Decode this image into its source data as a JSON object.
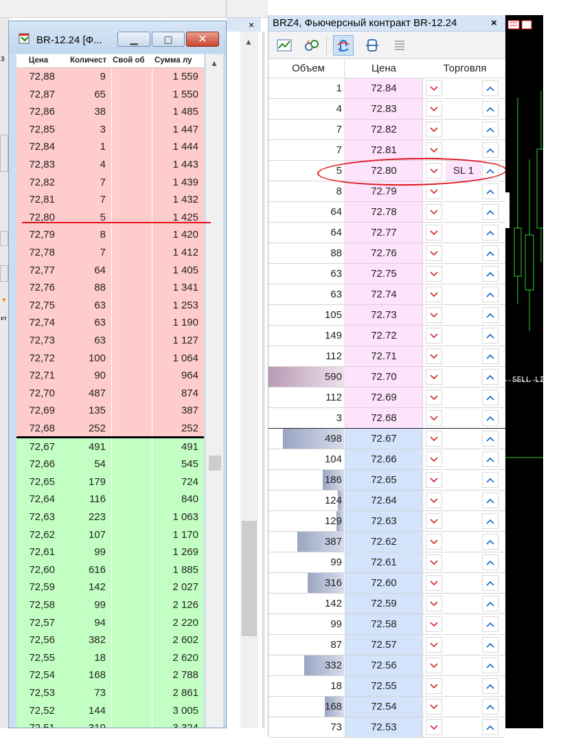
{
  "left_window": {
    "title": "BR-12.24 [Ф...",
    "columns": [
      "Цена",
      "Количест",
      "Свой об",
      "Сумма лу"
    ],
    "asks": [
      [
        "72,88",
        "9",
        "1 559"
      ],
      [
        "72,87",
        "65",
        "1 550"
      ],
      [
        "72,86",
        "38",
        "1 485"
      ],
      [
        "72,85",
        "3",
        "1 447"
      ],
      [
        "72,84",
        "1",
        "1 444"
      ],
      [
        "72,83",
        "4",
        "1 443"
      ],
      [
        "72,82",
        "7",
        "1 439"
      ],
      [
        "72,81",
        "7",
        "1 432"
      ],
      [
        "72,80",
        "5",
        "1 425"
      ],
      [
        "72,79",
        "8",
        "1 420"
      ],
      [
        "72,78",
        "7",
        "1 412"
      ],
      [
        "72,77",
        "64",
        "1 405"
      ],
      [
        "72,76",
        "88",
        "1 341"
      ],
      [
        "72,75",
        "63",
        "1 253"
      ],
      [
        "72,74",
        "63",
        "1 190"
      ],
      [
        "72,73",
        "63",
        "1 127"
      ],
      [
        "72,72",
        "100",
        "1 064"
      ],
      [
        "72,71",
        "90",
        "964"
      ],
      [
        "72,70",
        "487",
        "874"
      ],
      [
        "72,69",
        "135",
        "387"
      ],
      [
        "72,68",
        "252",
        "252"
      ]
    ],
    "bids": [
      [
        "72,67",
        "491",
        "491"
      ],
      [
        "72,66",
        "54",
        "545"
      ],
      [
        "72,65",
        "179",
        "724"
      ],
      [
        "72,64",
        "116",
        "840"
      ],
      [
        "72,63",
        "223",
        "1 063"
      ],
      [
        "72,62",
        "107",
        "1 170"
      ],
      [
        "72,61",
        "99",
        "1 269"
      ],
      [
        "72,60",
        "616",
        "1 885"
      ],
      [
        "72,59",
        "142",
        "2 027"
      ],
      [
        "72,58",
        "99",
        "2 126"
      ],
      [
        "72,57",
        "94",
        "2 220"
      ],
      [
        "72,56",
        "382",
        "2 602"
      ],
      [
        "72,55",
        "18",
        "2 620"
      ],
      [
        "72,54",
        "168",
        "2 788"
      ],
      [
        "72,53",
        "73",
        "2 861"
      ],
      [
        "72,52",
        "144",
        "3 005"
      ],
      [
        "72,51",
        "319",
        "3 324"
      ]
    ]
  },
  "left_edge_glyph": "3",
  "left_edge_text": "кт",
  "dom_window": {
    "title": "BRZ4, Фьючерсный контракт BR-12.24",
    "close_label": "×",
    "headers": {
      "volume": "Объем",
      "price": "Цена",
      "trade": "Торговля"
    },
    "asks": [
      {
        "vol": "1",
        "price": "72.84"
      },
      {
        "vol": "4",
        "price": "72.83"
      },
      {
        "vol": "7",
        "price": "72.82"
      },
      {
        "vol": "7",
        "price": "72.81"
      },
      {
        "vol": "5",
        "price": "72.80",
        "order": "SL 1"
      },
      {
        "vol": "8",
        "price": "72.79"
      },
      {
        "vol": "64",
        "price": "72.78"
      },
      {
        "vol": "64",
        "price": "72.77"
      },
      {
        "vol": "88",
        "price": "72.76"
      },
      {
        "vol": "63",
        "price": "72.75"
      },
      {
        "vol": "63",
        "price": "72.74"
      },
      {
        "vol": "105",
        "price": "72.73"
      },
      {
        "vol": "149",
        "price": "72.72"
      },
      {
        "vol": "112",
        "price": "72.71"
      },
      {
        "vol": "590",
        "price": "72.70",
        "depth": 1.0
      },
      {
        "vol": "112",
        "price": "72.69"
      },
      {
        "vol": "3",
        "price": "72.68"
      }
    ],
    "bids": [
      {
        "vol": "498",
        "price": "72.67",
        "depth": 0.81
      },
      {
        "vol": "104",
        "price": "72.66"
      },
      {
        "vol": "186",
        "price": "72.65",
        "depth": 0.28
      },
      {
        "vol": "124",
        "price": "72.64",
        "depth": 0.08
      },
      {
        "vol": "129",
        "price": "72.63",
        "depth": 0.1
      },
      {
        "vol": "387",
        "price": "72.62",
        "depth": 0.62
      },
      {
        "vol": "99",
        "price": "72.61"
      },
      {
        "vol": "316",
        "price": "72.60",
        "depth": 0.48
      },
      {
        "vol": "142",
        "price": "72.59"
      },
      {
        "vol": "99",
        "price": "72.58"
      },
      {
        "vol": "87",
        "price": "72.57"
      },
      {
        "vol": "332",
        "price": "72.56",
        "depth": 0.53
      },
      {
        "vol": "18",
        "price": "72.55"
      },
      {
        "vol": "168",
        "price": "72.54",
        "depth": 0.25
      },
      {
        "vol": "73",
        "price": "72.53"
      }
    ]
  },
  "mid_close": "×",
  "chart": {
    "sell_limit_label": "SELL LI"
  },
  "colors": {
    "ask_row": "#ffcccc",
    "bid_row": "#c3ffc3",
    "annotation": "#e0121b"
  }
}
